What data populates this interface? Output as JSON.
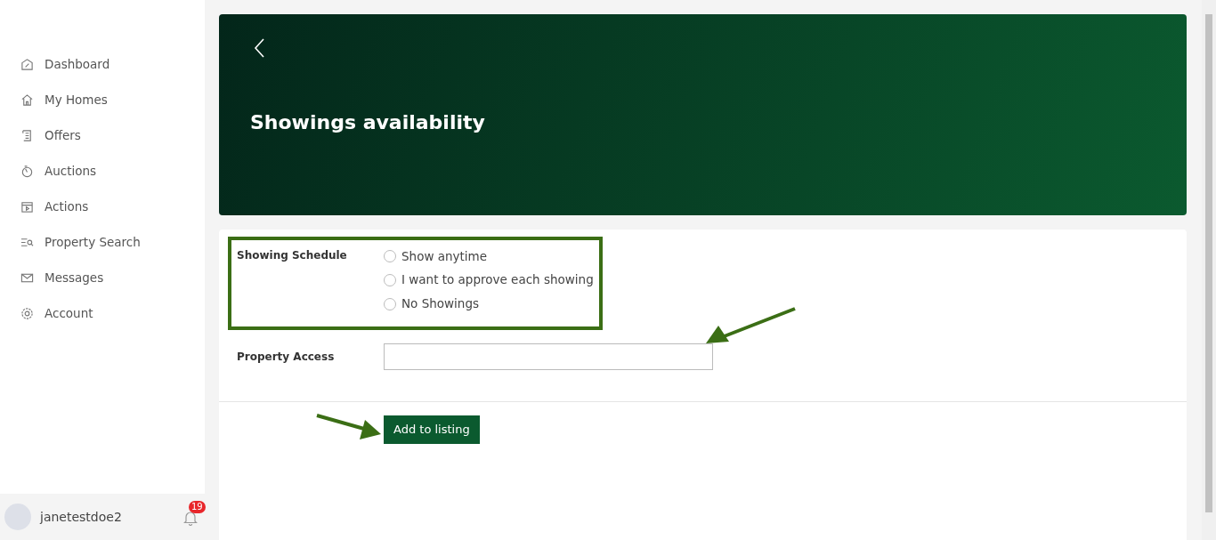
{
  "sidebar": {
    "items": [
      {
        "label": "Dashboard"
      },
      {
        "label": "My Homes"
      },
      {
        "label": "Offers"
      },
      {
        "label": "Auctions"
      },
      {
        "label": "Actions"
      },
      {
        "label": "Property Search"
      },
      {
        "label": "Messages"
      },
      {
        "label": "Account"
      }
    ],
    "user": {
      "name": "janetestdoe2",
      "notifications": "19"
    }
  },
  "header": {
    "title": "Showings availability"
  },
  "form": {
    "schedule": {
      "label": "Showing Schedule",
      "options": [
        {
          "label": "Show anytime",
          "selected": false
        },
        {
          "label": "I want to approve each showing",
          "selected": false
        },
        {
          "label": "No Showings",
          "selected": false
        }
      ]
    },
    "access": {
      "label": "Property Access"
    },
    "submit": "Add to listing"
  }
}
